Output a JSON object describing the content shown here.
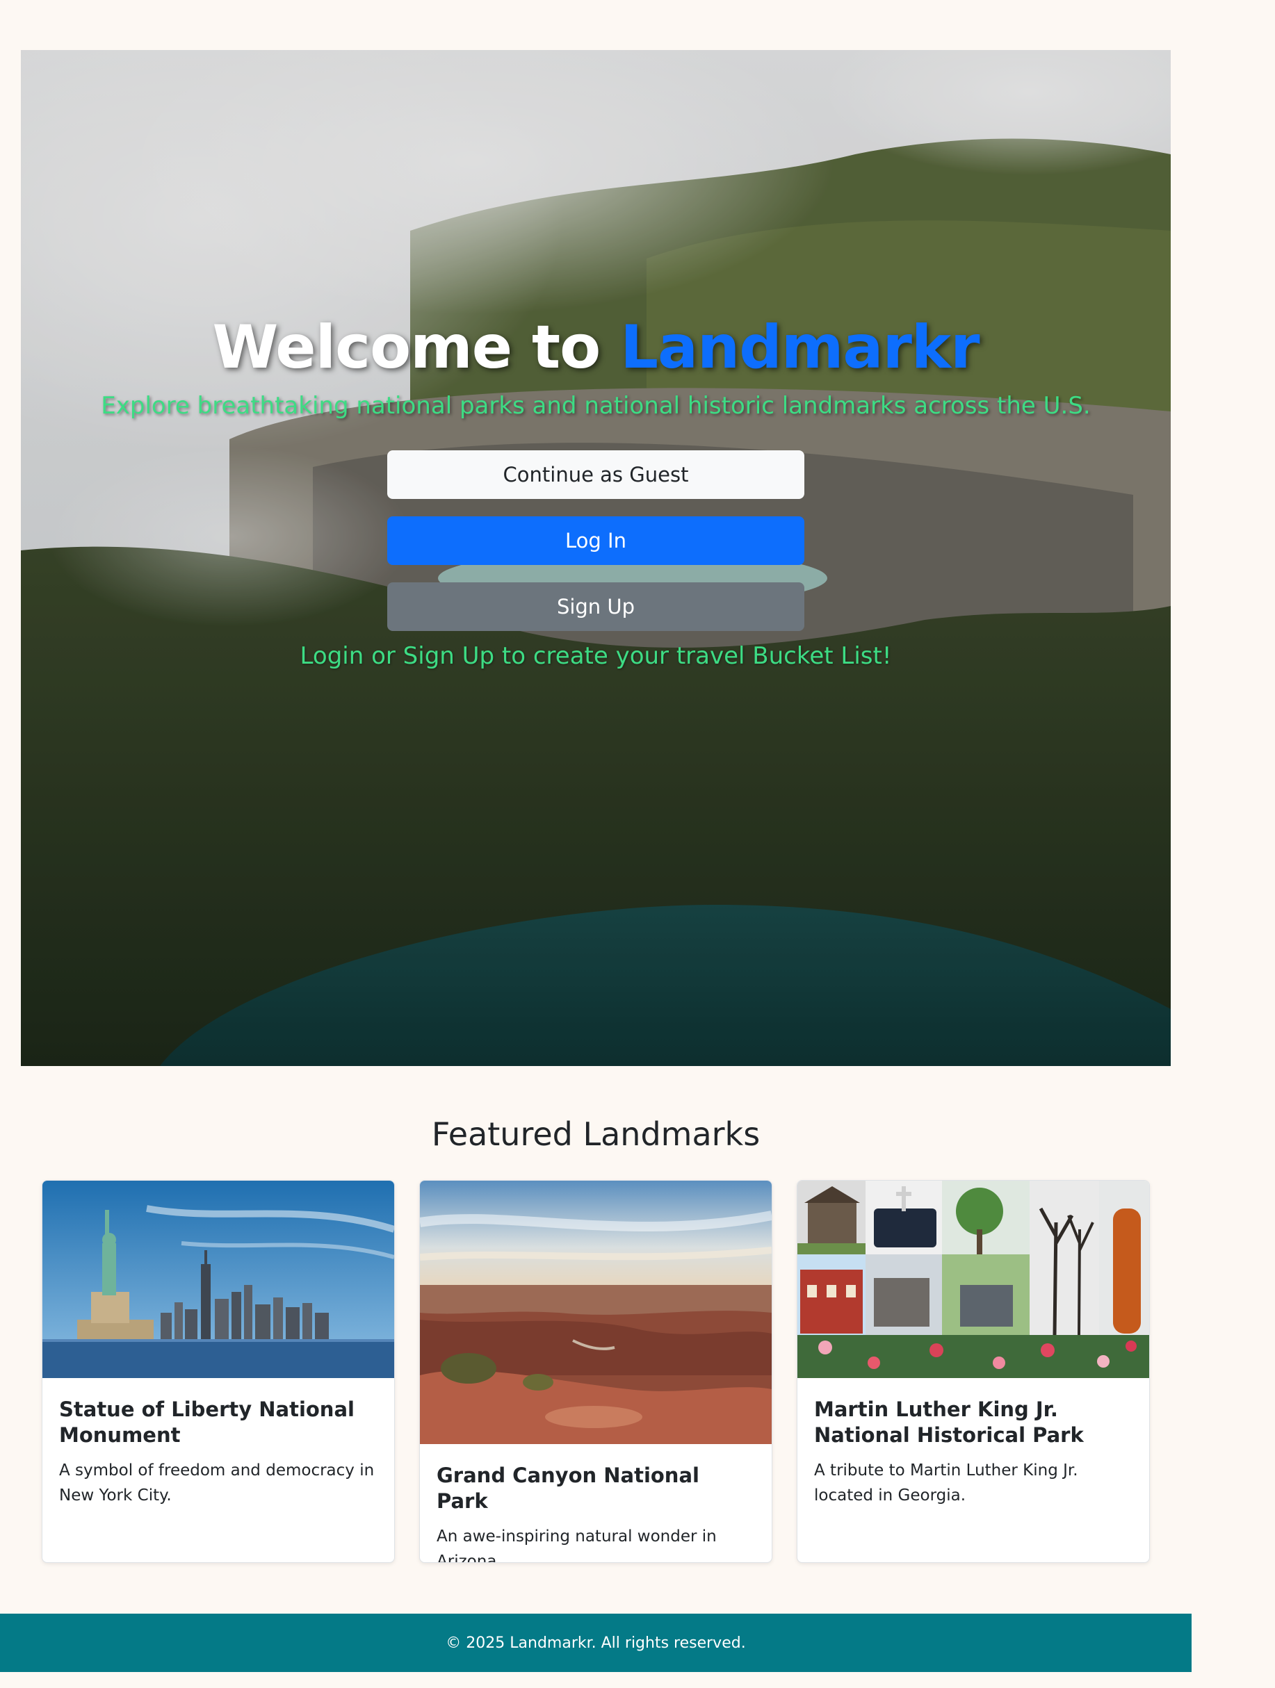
{
  "hero": {
    "title_prefix": "Welcome to ",
    "title_brand": "Landmarkr",
    "subtitle": "Explore breathtaking national parks and national historic landmarks across the U.S.",
    "guest_button": "Continue as Guest",
    "login_button": "Log In",
    "signup_button": "Sign Up",
    "cta": "Login or Sign Up to create your travel Bucket List!"
  },
  "featured": {
    "heading": "Featured Landmarks",
    "cards": [
      {
        "title": "Statue of Liberty National Monument",
        "description": "A symbol of freedom and democracy in New York City."
      },
      {
        "title": "Grand Canyon National Park",
        "description": "An awe-inspiring natural wonder in Arizona."
      },
      {
        "title": "Martin Luther King Jr. National Historical Park",
        "description": "A tribute to Martin Luther King Jr. located in Georgia."
      }
    ]
  },
  "footer": {
    "text": "© 2025 Landmarkr. All rights reserved."
  },
  "colors": {
    "page_background": "#fdf8f3",
    "brand_blue": "#0d6efd",
    "accent_green": "#3ddc84",
    "secondary_gray": "#6c757d",
    "footer_teal": "#047a87"
  }
}
